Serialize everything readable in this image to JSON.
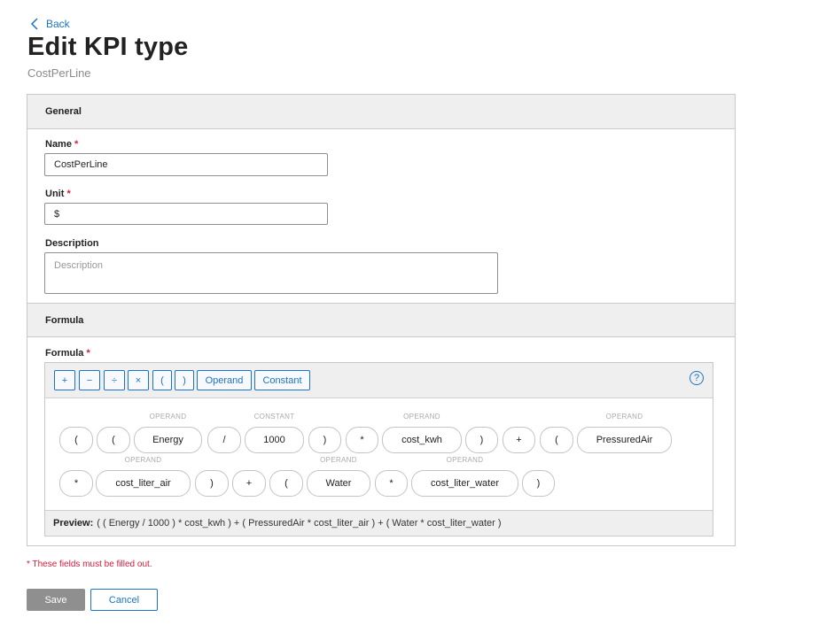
{
  "header": {
    "back_label": "Back",
    "title": "Edit KPI type",
    "subtitle": "CostPerLine"
  },
  "general": {
    "section_title": "General",
    "name_label": "Name",
    "name_value": "CostPerLine",
    "unit_label": "Unit",
    "unit_value": "$",
    "description_label": "Description",
    "description_placeholder": "Description",
    "required_mark": "*"
  },
  "formula": {
    "section_title": "Formula",
    "field_label": "Formula",
    "toolbar": {
      "plus": "+",
      "minus": "−",
      "divide": "÷",
      "multiply": "×",
      "open_paren": "(",
      "close_paren": ")",
      "operand": "Operand",
      "constant": "Constant",
      "help": "?"
    },
    "tokens": [
      {
        "text": "(",
        "caption": ""
      },
      {
        "text": "(",
        "caption": ""
      },
      {
        "text": "Energy",
        "caption": "OPERAND"
      },
      {
        "text": "/",
        "caption": ""
      },
      {
        "text": "1000",
        "caption": "CONSTANT"
      },
      {
        "text": ")",
        "caption": ""
      },
      {
        "text": "*",
        "caption": ""
      },
      {
        "text": "cost_kwh",
        "caption": "OPERAND"
      },
      {
        "text": ")",
        "caption": ""
      },
      {
        "text": "+",
        "caption": ""
      },
      {
        "text": "(",
        "caption": ""
      },
      {
        "text": "PressuredAir",
        "caption": "OPERAND"
      },
      {
        "text": "*",
        "caption": ""
      },
      {
        "text": "cost_liter_air",
        "caption": "OPERAND"
      },
      {
        "text": ")",
        "caption": ""
      },
      {
        "text": "+",
        "caption": ""
      },
      {
        "text": "(",
        "caption": ""
      },
      {
        "text": "Water",
        "caption": "OPERAND"
      },
      {
        "text": "*",
        "caption": ""
      },
      {
        "text": "cost_liter_water",
        "caption": "OPERAND"
      },
      {
        "text": ")",
        "caption": ""
      }
    ],
    "preview_label": "Preview:",
    "preview_value": "( ( Energy / 1000 ) * cost_kwh ) + ( PressuredAir * cost_liter_air ) + ( Water * cost_liter_water )"
  },
  "footer": {
    "required_note": "* These fields must be filled out.",
    "save_label": "Save",
    "cancel_label": "Cancel"
  },
  "colors": {
    "accent": "#1a73c7",
    "required": "#d61b3b",
    "section_bg": "#efefef",
    "save_disabled": "#8f8f8f"
  }
}
